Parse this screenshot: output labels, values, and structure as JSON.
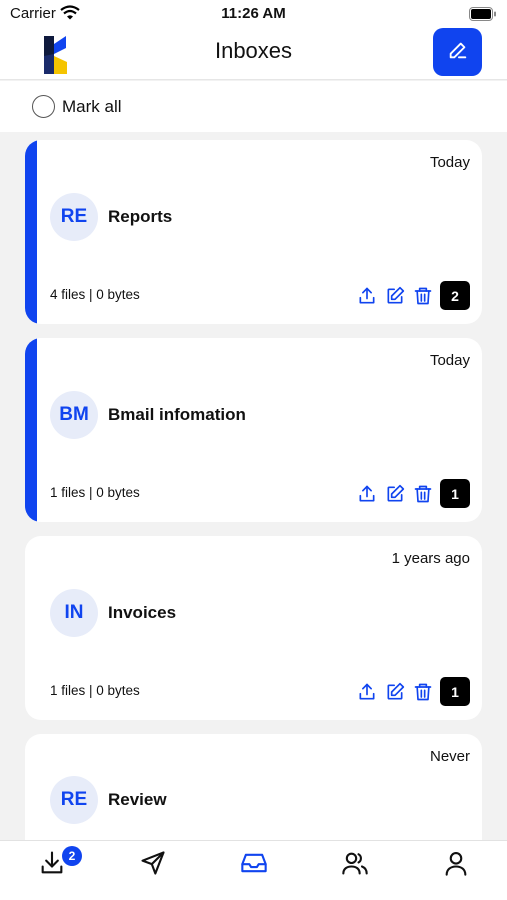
{
  "status_bar": {
    "carrier": "Carrier",
    "time": "11:26 AM"
  },
  "header": {
    "title": "Inboxes"
  },
  "mark_all": {
    "label": "Mark all"
  },
  "inboxes": [
    {
      "initials": "RE",
      "name": "Reports",
      "time": "Today",
      "meta": "4 files | 0 bytes",
      "count": "2",
      "accent": true
    },
    {
      "initials": "BM",
      "name": "Bmail infomation",
      "time": "Today",
      "meta": "1 files | 0 bytes",
      "count": "1",
      "accent": true
    },
    {
      "initials": "IN",
      "name": "Invoices",
      "time": "1 years ago",
      "meta": "1 files | 0 bytes",
      "count": "1",
      "accent": false
    },
    {
      "initials": "RE",
      "name": "Review",
      "time": "Never",
      "meta": "",
      "count": "",
      "accent": false
    }
  ],
  "tab_bar": {
    "downloads_badge": "2",
    "tabs": [
      "download-icon",
      "send-icon",
      "inbox-icon",
      "users-icon",
      "profile-icon"
    ],
    "active_tab": "inbox-icon"
  },
  "colors": {
    "accent": "#1044ef",
    "avatar_bg": "#e7ecf9",
    "background": "#f2f2f2",
    "count_badge": "#000000"
  }
}
